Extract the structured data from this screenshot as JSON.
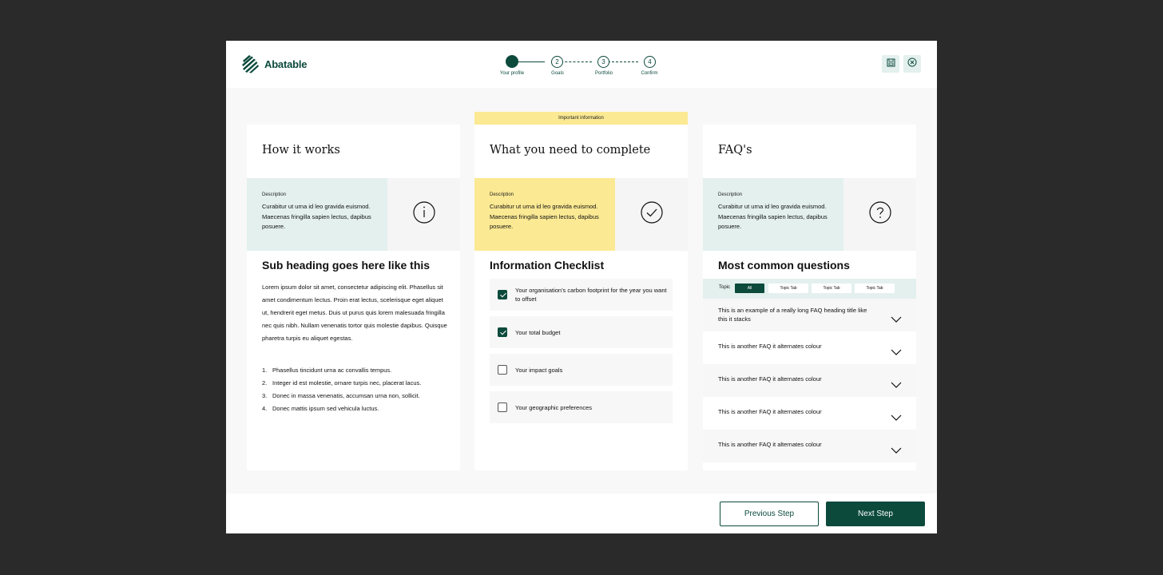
{
  "app": {
    "brand": "Abatable",
    "brand_color": "#0c4a3c",
    "logo_icon": "striped-leaf-icon"
  },
  "stepper": {
    "steps": [
      {
        "number": "",
        "label": "Your profile",
        "state": "active"
      },
      {
        "number": "2",
        "label": "Goals",
        "state": "upcoming"
      },
      {
        "number": "3",
        "label": "Portfolio",
        "state": "upcoming"
      },
      {
        "number": "4",
        "label": "Confirm",
        "state": "upcoming"
      }
    ]
  },
  "header_actions": {
    "save_icon": "save-icon",
    "close_icon": "close-circle-icon"
  },
  "banner": {
    "text": "Important information",
    "color": "#fbe993"
  },
  "columns": {
    "how": {
      "title": "How it works",
      "desc_label": "Description",
      "desc_text": "Curabitur ut urna id leo gravida euismod. Maecenas fringilla sapien lectus, dapibus posuere.",
      "desc_bg": "#e3f0ee",
      "icon": "info-icon",
      "sub_heading": "Sub heading goes here like this",
      "paragraph": "Lorem ipsum dolor sit amet, consectetur adipiscing elit. Phasellus sit amet condimentum lectus. Proin erat lectus, scelerisque eget aliquet ut, hendrerit eget metus. Duis ut purus quis lorem malesuada fringilla nec quis nibh. Nullam venenatis tortor quis molestie dapibus. Quisque pharetra turpis eu aliquet egestas.",
      "list": [
        {
          "n": "1.",
          "text": "Phasellus tincidunt urna ac convallis tempus."
        },
        {
          "n": "2.",
          "text": "Integer id est molestie, ornare turpis nec, placerat lacus."
        },
        {
          "n": "3.",
          "text": "Donec in massa venenatis, accumsan urna non, sollicit."
        },
        {
          "n": "4.",
          "text": "Donec mattis ipsum sed vehicula luctus."
        }
      ]
    },
    "need": {
      "title": "What you need to complete",
      "desc_label": "Description",
      "desc_text": "Curabitur ut urna id leo gravida euismod. Maecenas fringilla sapien lectus, dapibus posuere.",
      "desc_bg": "#fbe993",
      "icon": "check-circle-icon",
      "sub_heading": "Information Checklist",
      "checklist": [
        {
          "text": "Your organisation's carbon footprint for the year you want to offset",
          "checked": true
        },
        {
          "text": "Your total budget",
          "checked": true
        },
        {
          "text": "Your impact goals",
          "checked": false
        },
        {
          "text": "Your geographic preferences",
          "checked": false
        }
      ]
    },
    "faq": {
      "title": "FAQ's",
      "desc_label": "Description",
      "desc_text": "Curabitur ut urna id leo gravida euismod. Maecenas fringilla sapien lectus, dapibus posuere.",
      "desc_bg": "#e3f0ee",
      "icon": "question-circle-icon",
      "sub_heading": "Most common questions",
      "topic_label": "Topic",
      "topic_tabs": [
        {
          "label": "All",
          "active": true
        },
        {
          "label": "Topic Tab",
          "active": false
        },
        {
          "label": "Topic Tab",
          "active": false
        },
        {
          "label": "Topic Tab",
          "active": false
        }
      ],
      "faqs": [
        {
          "text": "This is an example of a really long FAQ heading title like this it stacks"
        },
        {
          "text": "This is another FAQ it alternates colour"
        },
        {
          "text": "This is another FAQ it alternates colour"
        },
        {
          "text": "This is another FAQ it alternates colour"
        },
        {
          "text": "This is another FAQ it alternates colour"
        }
      ]
    }
  },
  "footer": {
    "prev_label": "Previous Step",
    "next_label": "Next Step"
  }
}
